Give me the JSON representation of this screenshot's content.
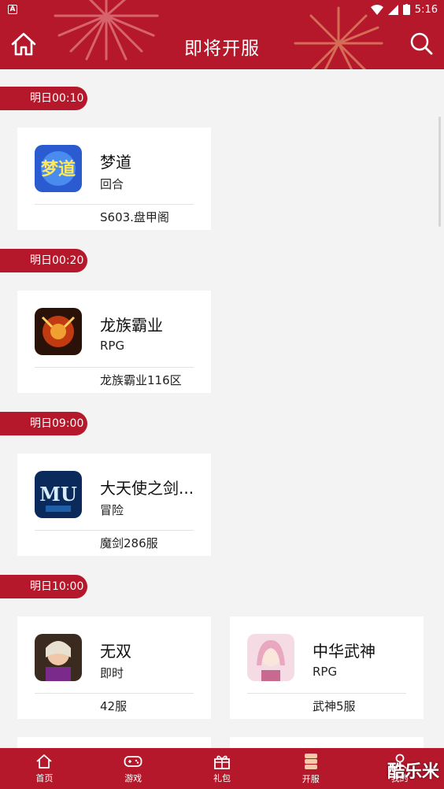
{
  "status_bar": {
    "time": "5:16"
  },
  "header": {
    "title": "即将开服"
  },
  "groups": [
    {
      "time": "明日00:10",
      "cards": [
        {
          "name": "梦道",
          "genre": "回合",
          "server": "S603.盘甲阁",
          "icon": "mengdao-game-icon"
        }
      ]
    },
    {
      "time": "明日00:20",
      "cards": [
        {
          "name": "龙族霸业",
          "genre": "RPG",
          "server": "龙族霸业116区",
          "icon": "dragon-game-icon"
        }
      ]
    },
    {
      "time": "明日09:00",
      "cards": [
        {
          "name": "大天使之剑...",
          "genre": "冒险",
          "server": "魔剑286服",
          "icon": "mu-game-icon"
        }
      ]
    },
    {
      "time": "明日10:00",
      "cards": [
        {
          "name": "无双",
          "genre": "即时",
          "server": "42服",
          "icon": "wushuang-game-icon"
        },
        {
          "name": "中华武神",
          "genre": "RPG",
          "server": "武神5服",
          "icon": "wushen-game-icon"
        }
      ]
    }
  ],
  "bottom_nav": [
    {
      "label": "首页",
      "icon": "home-icon"
    },
    {
      "label": "游戏",
      "icon": "gamepad-icon"
    },
    {
      "label": "礼包",
      "icon": "gift-icon"
    },
    {
      "label": "开服",
      "icon": "server-icon"
    },
    {
      "label": "我的",
      "icon": "user-icon"
    }
  ],
  "watermark": "酷乐米",
  "colors": {
    "brand": "#b5182b",
    "background": "#f3f3f3"
  }
}
